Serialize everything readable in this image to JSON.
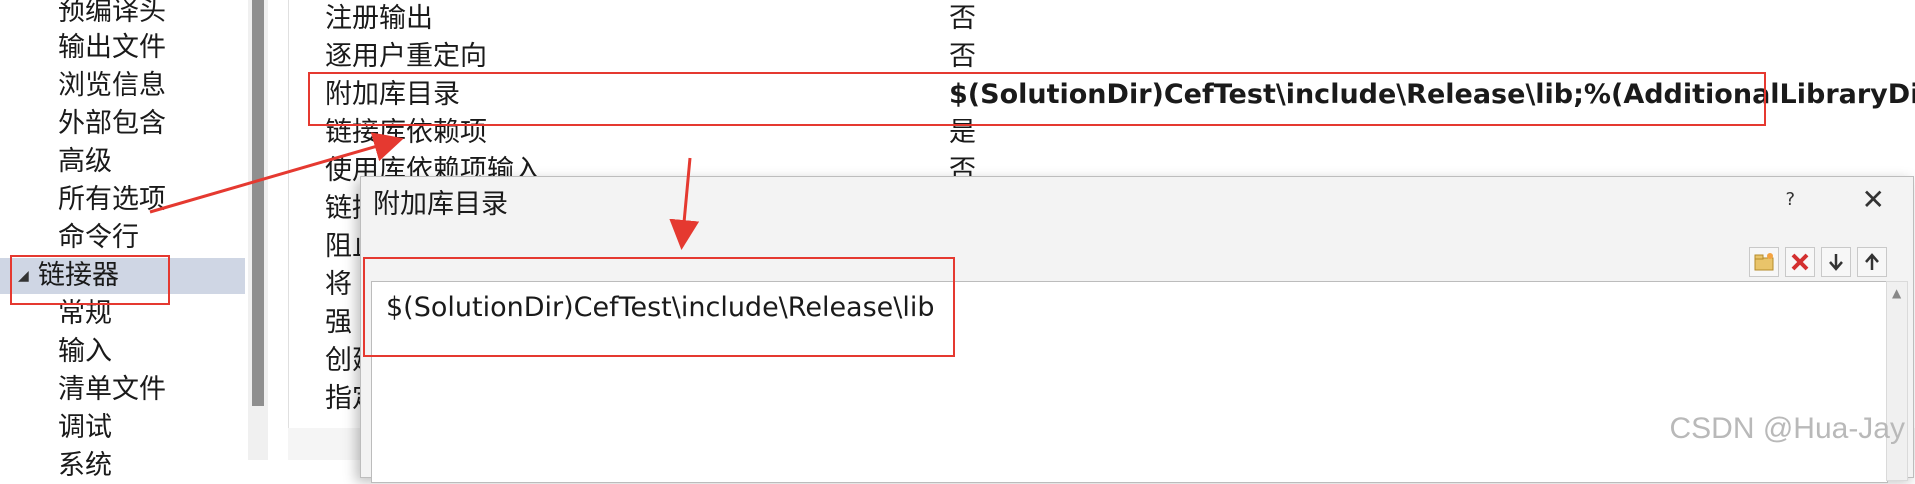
{
  "tree": {
    "items": [
      {
        "label": "预编译头"
      },
      {
        "label": "输出文件"
      },
      {
        "label": "浏览信息"
      },
      {
        "label": "外部包含"
      },
      {
        "label": "高级"
      },
      {
        "label": "所有选项"
      },
      {
        "label": "命令行"
      },
      {
        "label": "链接器",
        "selected": true
      },
      {
        "label": "常规"
      },
      {
        "label": "输入"
      },
      {
        "label": "清单文件"
      },
      {
        "label": "调试"
      },
      {
        "label": "系统"
      }
    ]
  },
  "grid": {
    "rows": [
      {
        "name": "注册输出",
        "value": "否"
      },
      {
        "name": "逐用户重定向",
        "value": "否"
      },
      {
        "name": "附加库目录",
        "value": "$(SolutionDir)CefTest\\include\\Release\\lib;%(AdditionalLibraryDirecto",
        "highlight": true
      },
      {
        "name": "链接库依赖项",
        "value": "是"
      },
      {
        "name": "使用库依赖项输入",
        "value": "否"
      },
      {
        "name": "链接",
        "value": ""
      },
      {
        "name": "阻止",
        "value": ""
      },
      {
        "name": "将",
        "value": ""
      },
      {
        "name": "强",
        "value": ""
      },
      {
        "name": "创建",
        "value": ""
      },
      {
        "name": "指定",
        "value": ""
      }
    ]
  },
  "dialog": {
    "title": "附加库目录",
    "help": "?",
    "close": "✕",
    "editor_text": "$(SolutionDir)CefTest\\include\\Release\\lib",
    "toolbar": {
      "new_folder_icon": "new-folder-icon",
      "delete_icon": "delete-icon",
      "move_down_icon": "move-down-icon",
      "move_up_icon": "move-up-icon"
    }
  },
  "annotation_color": "#e53930",
  "watermark": "CSDN @Hua-Jay"
}
